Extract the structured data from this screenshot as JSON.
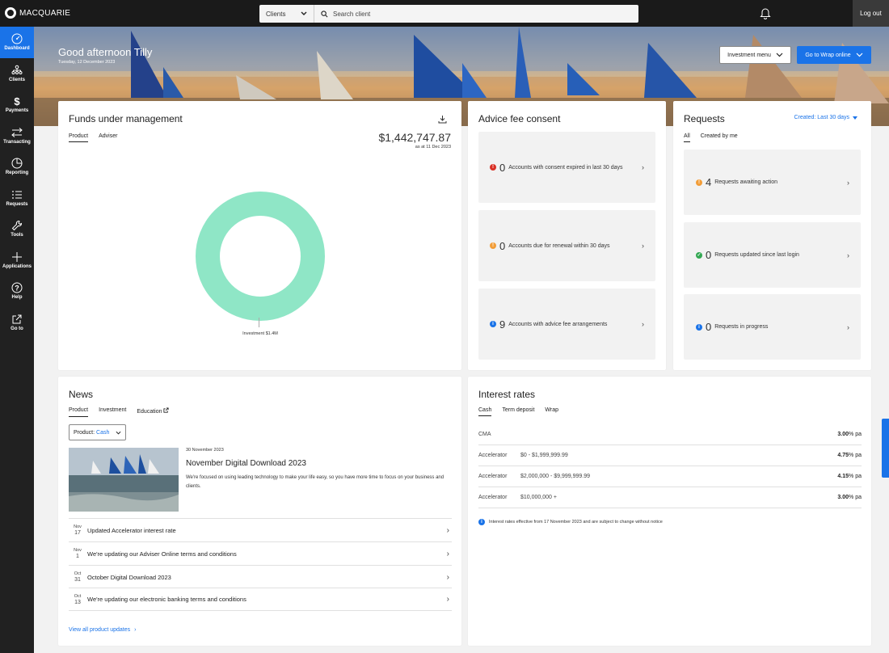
{
  "topbar": {
    "brand": "MACQUARIE",
    "search_scope": "Clients",
    "search_placeholder": "Search client",
    "logout": "Log out"
  },
  "sidebar": {
    "items": [
      {
        "label": "Dashboard",
        "icon": "dashboard-icon",
        "active": true
      },
      {
        "label": "Clients",
        "icon": "clients-icon"
      },
      {
        "label": "Payments",
        "icon": "dollar-icon"
      },
      {
        "label": "Transacting",
        "icon": "transfer-icon"
      },
      {
        "label": "Reporting",
        "icon": "pie-chart-icon"
      },
      {
        "label": "Requests",
        "icon": "list-icon"
      },
      {
        "label": "Tools",
        "icon": "wrench-icon"
      },
      {
        "label": "Applications",
        "icon": "plus-icon"
      },
      {
        "label": "Help",
        "icon": "help-icon"
      },
      {
        "label": "Go to",
        "icon": "external-link-icon"
      }
    ]
  },
  "hero": {
    "greeting": "Good afternoon Tilly",
    "date": "Tuesday, 12 December 2023",
    "investment_menu": "Investment menu",
    "wrap_button": "Go to Wrap online"
  },
  "funds": {
    "title": "Funds under management",
    "tabs": [
      "Product",
      "Adviser"
    ],
    "total": "$1,442,747.87",
    "as_at": "as at 11 Dec 2023",
    "chart_label": "Investment $1.4M",
    "chart_data": {
      "type": "pie",
      "categories": [
        "Investment"
      ],
      "values": [
        1442747.87
      ],
      "colors": [
        "#8fe6c6"
      ]
    }
  },
  "advice": {
    "title": "Advice fee consent",
    "items": [
      {
        "count": "0",
        "text": "Accounts with consent expired in last 30 days",
        "color": "#d93025",
        "symbol": "!"
      },
      {
        "count": "0",
        "text": "Accounts due for renewal within 30 days",
        "color": "#f29d38",
        "symbol": "!"
      },
      {
        "count": "9",
        "text": "Accounts with advice fee arrangements",
        "color": "#1a73e8",
        "symbol": "i"
      }
    ]
  },
  "requests": {
    "title": "Requests",
    "filter": "Created: Last 30 days",
    "tabs": [
      "All",
      "Created by me"
    ],
    "items": [
      {
        "count": "4",
        "text": "Requests awaiting action",
        "color": "#f29d38",
        "symbol": "!"
      },
      {
        "count": "0",
        "text": "Requests updated since last login",
        "color": "#34a853",
        "symbol": "✓"
      },
      {
        "count": "0",
        "text": "Requests in progress",
        "color": "#1a73e8",
        "symbol": "i"
      }
    ]
  },
  "news": {
    "title": "News",
    "tabs": [
      "Product",
      "Investment",
      "Education"
    ],
    "product_label": "Product:",
    "product_value": "Cash",
    "featured": {
      "date": "30 November 2023",
      "headline": "November Digital Download 2023",
      "summary": "We're focused on using leading technology to make your life easy, so you have more time to focus on your business and clients."
    },
    "items": [
      {
        "month": "Nov",
        "day": "17",
        "text": "Updated Accelerator interest rate"
      },
      {
        "month": "Nov",
        "day": "1",
        "text": "We're updating our Adviser Online terms and conditions"
      },
      {
        "month": "Oct",
        "day": "31",
        "text": "October Digital Download 2023"
      },
      {
        "month": "Oct",
        "day": "13",
        "text": "We're updating our electronic banking terms and conditions"
      }
    ],
    "view_all": "View all product updates"
  },
  "rates": {
    "title": "Interest rates",
    "tabs": [
      "Cash",
      "Term deposit",
      "Wrap"
    ],
    "rows": [
      {
        "name": "CMA",
        "range": "",
        "rate": "3.00",
        "unit": "% pa"
      },
      {
        "name": "Accelerator",
        "range": "$0 - $1,999,999.99",
        "rate": "4.75",
        "unit": "% pa"
      },
      {
        "name": "Accelerator",
        "range": "$2,000,000 - $9,999,999.99",
        "rate": "4.15",
        "unit": "% pa"
      },
      {
        "name": "Accelerator",
        "range": "$10,000,000 +",
        "rate": "3.00",
        "unit": "% pa"
      }
    ],
    "note": "Interest rates effective from 17 November 2023 and are subject to change without notice"
  }
}
